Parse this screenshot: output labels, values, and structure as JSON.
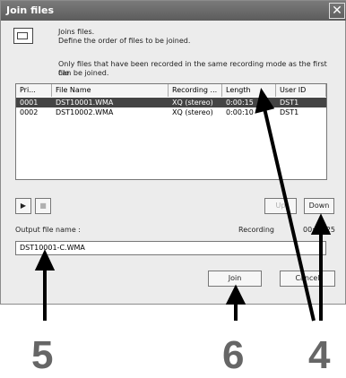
{
  "window": {
    "title": "Join files",
    "close_symbol": "✕"
  },
  "info": {
    "line1": "Joins files.",
    "line2": "Define the order of files to be joined.",
    "line3": "Only files that have been recorded in the same recording mode as the first file",
    "line4": "can be joined."
  },
  "table": {
    "headers": [
      "Pri...",
      "File Name",
      "Recording ...",
      "Length",
      "User ID"
    ],
    "rows": [
      {
        "pri": "0001",
        "file": "DST10001.WMA",
        "mode": "XQ (stereo)",
        "length": "0:00:15",
        "user": "DST1"
      },
      {
        "pri": "0002",
        "file": "DST10002.WMA",
        "mode": "XQ (stereo)",
        "length": "0:00:10",
        "user": "DST1"
      }
    ]
  },
  "controls": {
    "play": "▶",
    "stop": "■",
    "up": "Up",
    "down": "Down"
  },
  "output": {
    "label": "Output file name :",
    "recording_label": "Recording",
    "recording_time": "00:00:25",
    "filename": "DST10001-C.WMA"
  },
  "buttons": {
    "join": "Join",
    "cancel": "Cancel"
  },
  "callouts": {
    "five": "5",
    "six": "6",
    "four": "4"
  }
}
